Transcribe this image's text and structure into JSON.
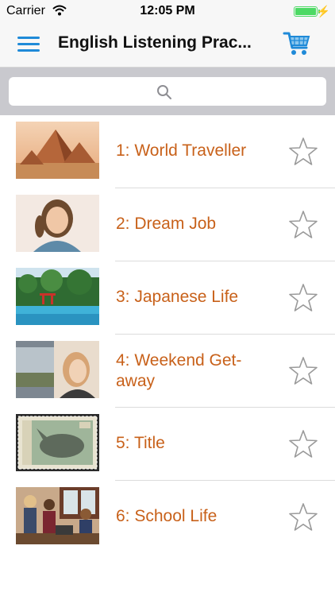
{
  "status_bar": {
    "carrier": "Carrier",
    "time": "12:05 PM",
    "battery_level": 1.0
  },
  "nav": {
    "title": "English Listening Prac...",
    "menu_icon": "hamburger-icon",
    "cart_icon": "shopping-cart-icon"
  },
  "search": {
    "placeholder": "",
    "icon": "search-icon"
  },
  "lessons": [
    {
      "title": "1: World Traveller",
      "image": "pyramids",
      "favorite": false
    },
    {
      "title": "2: Dream Job",
      "image": "girl-portrait",
      "favorite": false
    },
    {
      "title": "3: Japanese Life",
      "image": "lake-shrine",
      "favorite": false
    },
    {
      "title": "4: Weekend Get-away",
      "image": "woman-train-window",
      "favorite": false
    },
    {
      "title": "5: Title",
      "image": "rhino-stamp",
      "favorite": false
    },
    {
      "title": "6: School Life",
      "image": "students-laptop",
      "favorite": false
    }
  ],
  "colors": {
    "accent": "#1f8ad8",
    "title_text": "#c8611a"
  }
}
